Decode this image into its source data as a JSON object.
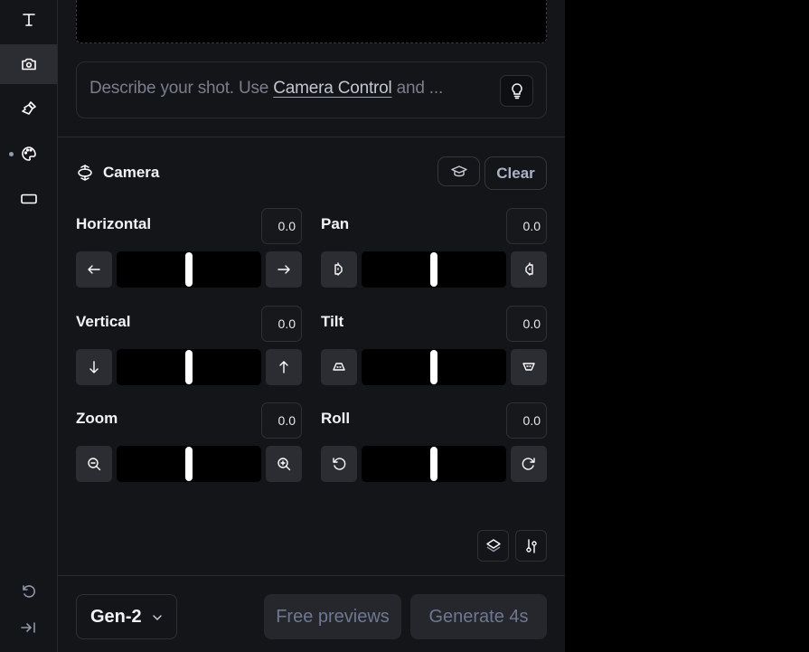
{
  "sidebar": {
    "items": [
      {
        "name": "text",
        "icon": "text-icon",
        "active": false
      },
      {
        "name": "camera",
        "icon": "camera-icon",
        "active": true
      },
      {
        "name": "brush",
        "icon": "brush-icon",
        "active": false
      },
      {
        "name": "palette",
        "icon": "palette-icon",
        "active": false,
        "dot": true
      },
      {
        "name": "aspect-ratio",
        "icon": "aspect-ratio-icon",
        "active": false
      }
    ],
    "bottom": [
      {
        "name": "reset",
        "icon": "reset-icon"
      },
      {
        "name": "collapse",
        "icon": "collapse-icon"
      }
    ]
  },
  "prompt": {
    "placeholder_before": "Describe your shot. Use ",
    "placeholder_link": "Camera Control",
    "placeholder_after": " and ...",
    "hint_icon": "lightbulb-icon"
  },
  "camera": {
    "title": "Camera",
    "tutorial_icon": "graduation-cap-icon",
    "clear_label": "Clear",
    "controls": [
      {
        "id": "horizontal",
        "label": "Horizontal",
        "value": "0.0",
        "slider_fraction": 0.5,
        "left_icon": "arrow-left-icon",
        "right_icon": "arrow-right-icon"
      },
      {
        "id": "pan",
        "label": "Pan",
        "value": "0.0",
        "slider_fraction": 0.5,
        "left_icon": "pan-left-icon",
        "right_icon": "pan-right-icon"
      },
      {
        "id": "vertical",
        "label": "Vertical",
        "value": "0.0",
        "slider_fraction": 0.5,
        "left_icon": "arrow-down-icon",
        "right_icon": "arrow-up-icon"
      },
      {
        "id": "tilt",
        "label": "Tilt",
        "value": "0.0",
        "slider_fraction": 0.5,
        "left_icon": "tilt-up-icon",
        "right_icon": "tilt-down-icon"
      },
      {
        "id": "zoom",
        "label": "Zoom",
        "value": "0.0",
        "slider_fraction": 0.5,
        "left_icon": "zoom-out-icon",
        "right_icon": "zoom-in-icon"
      },
      {
        "id": "roll",
        "label": "Roll",
        "value": "0.0",
        "slider_fraction": 0.5,
        "left_icon": "rotate-ccw-icon",
        "right_icon": "rotate-cw-icon"
      }
    ]
  },
  "toolbar": {
    "layers_icon": "layers-icon",
    "settings_icon": "sliders-icon"
  },
  "footer": {
    "model": "Gen-2",
    "free_previews_label": "Free previews",
    "generate_label": "Generate 4s"
  }
}
